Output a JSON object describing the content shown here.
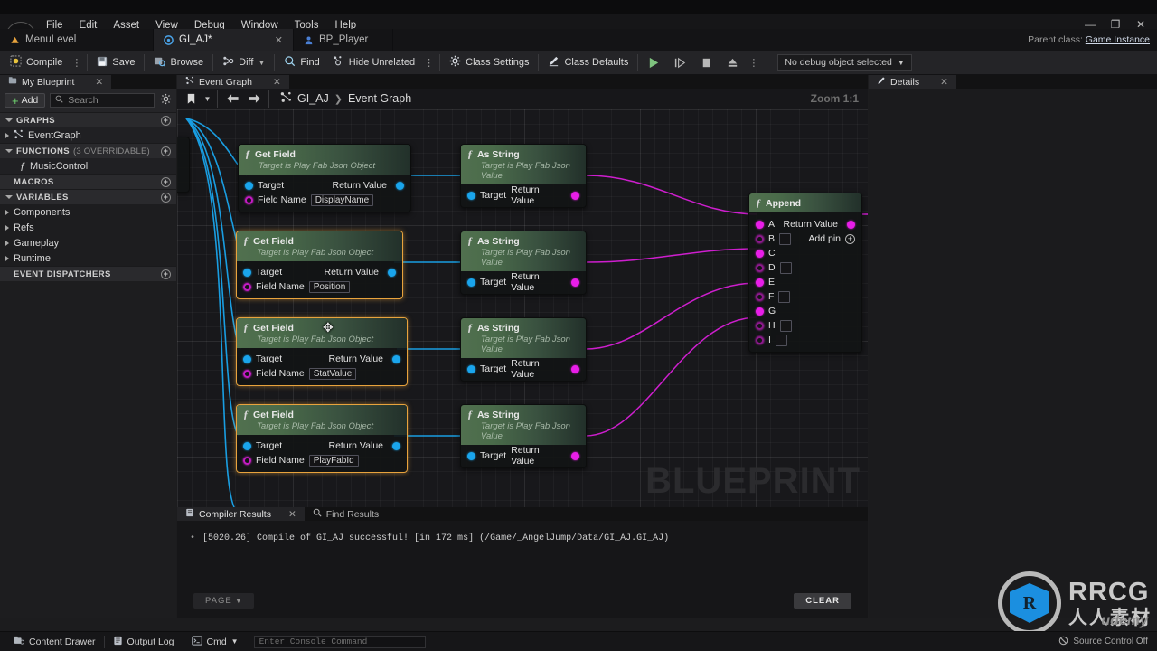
{
  "menu": {
    "items": [
      "File",
      "Edit",
      "Asset",
      "View",
      "Debug",
      "Window",
      "Tools",
      "Help"
    ]
  },
  "window_controls": {
    "minimize": "—",
    "maximize": "❐",
    "close": "✕"
  },
  "asset_tabs": [
    {
      "label": "MenuLevel",
      "icon": "level-icon",
      "active": false,
      "closable": false
    },
    {
      "label": "GI_AJ*",
      "icon": "blueprint-icon",
      "active": true,
      "closable": true,
      "close": "✕"
    },
    {
      "label": "BP_Player",
      "icon": "player-blueprint-icon",
      "active": false,
      "closable": false
    }
  ],
  "parent_class": {
    "label": "Parent class:",
    "value": "Game Instance"
  },
  "toolbar": {
    "compile": "Compile",
    "save": "Save",
    "browse": "Browse",
    "diff": "Diff",
    "find": "Find",
    "hide_unrelated": "Hide Unrelated",
    "class_settings": "Class Settings",
    "class_defaults": "Class Defaults",
    "debug_object": "No debug object selected"
  },
  "my_blueprint": {
    "tab_label": "My Blueprint",
    "add_label": "Add",
    "search_placeholder": "Search",
    "sections": [
      {
        "title": "GRAPHS",
        "sub": "",
        "expanded": true,
        "has_add": true
      },
      {
        "title": "FUNCTIONS",
        "sub": "(3 OVERRIDABLE)",
        "expanded": true,
        "has_add": true
      },
      {
        "title": "MACROS",
        "sub": "",
        "expanded": false,
        "has_add": true
      },
      {
        "title": "VARIABLES",
        "sub": "",
        "expanded": true,
        "has_add": true
      },
      {
        "title": "EVENT DISPATCHERS",
        "sub": "",
        "expanded": false,
        "has_add": true
      }
    ],
    "event_graph": "EventGraph",
    "function_item": "MusicControl",
    "variable_categories": [
      "Components",
      "Refs",
      "Gameplay",
      "Runtime"
    ]
  },
  "graph": {
    "tab_label": "Event Graph",
    "breadcrumb_root": "GI_AJ",
    "breadcrumb_sep": "❯",
    "breadcrumb_current": "Event Graph",
    "zoom_label": "Zoom 1:1",
    "watermark": "BLUEPRINT",
    "nodes": [
      {
        "id": "getfield-1",
        "title": "Get Field",
        "subtitle": "Target is Play Fab Json Object",
        "selected": false,
        "inputs": [
          {
            "label": "Target",
            "type": "object"
          },
          {
            "label": "Field Name",
            "type": "string",
            "value": "DisplayName"
          }
        ],
        "outputs": [
          {
            "label": "Return Value",
            "type": "object"
          }
        ]
      },
      {
        "id": "asstring-1",
        "title": "As String",
        "subtitle": "Target is Play Fab Json Value",
        "selected": false,
        "inputs": [
          {
            "label": "Target",
            "type": "object"
          }
        ],
        "outputs": [
          {
            "label": "Return Value",
            "type": "string"
          }
        ]
      },
      {
        "id": "getfield-2",
        "title": "Get Field",
        "subtitle": "Target is Play Fab Json Object",
        "selected": true,
        "inputs": [
          {
            "label": "Target",
            "type": "object"
          },
          {
            "label": "Field Name",
            "type": "string",
            "value": "Position"
          }
        ],
        "outputs": [
          {
            "label": "Return Value",
            "type": "object"
          }
        ]
      },
      {
        "id": "asstring-2",
        "title": "As String",
        "subtitle": "Target is Play Fab Json Value",
        "selected": false,
        "inputs": [
          {
            "label": "Target",
            "type": "object"
          }
        ],
        "outputs": [
          {
            "label": "Return Value",
            "type": "string"
          }
        ]
      },
      {
        "id": "getfield-3",
        "title": "Get Field",
        "subtitle": "Target is Play Fab Json Object",
        "selected": true,
        "inputs": [
          {
            "label": "Target",
            "type": "object"
          },
          {
            "label": "Field Name",
            "type": "string",
            "value": "StatValue"
          }
        ],
        "outputs": [
          {
            "label": "Return Value",
            "type": "object"
          }
        ]
      },
      {
        "id": "asstring-3",
        "title": "As String",
        "subtitle": "Target is Play Fab Json Value",
        "selected": false,
        "inputs": [
          {
            "label": "Target",
            "type": "object"
          }
        ],
        "outputs": [
          {
            "label": "Return Value",
            "type": "string"
          }
        ]
      },
      {
        "id": "getfield-4",
        "title": "Get Field",
        "subtitle": "Target is Play Fab Json Object",
        "selected": true,
        "inputs": [
          {
            "label": "Target",
            "type": "object"
          },
          {
            "label": "Field Name",
            "type": "string",
            "value": "PlayFabId"
          }
        ],
        "outputs": [
          {
            "label": "Return Value",
            "type": "object"
          }
        ]
      },
      {
        "id": "asstring-4",
        "title": "As String",
        "subtitle": "Target is Play Fab Json Value",
        "selected": false,
        "inputs": [
          {
            "label": "Target",
            "type": "object"
          }
        ],
        "outputs": [
          {
            "label": "Return Value",
            "type": "string"
          }
        ]
      }
    ],
    "append_node": {
      "title": "Append",
      "pins": [
        {
          "label": "A",
          "connected": true,
          "has_field": false
        },
        {
          "label": "B",
          "connected": false,
          "has_field": true,
          "value": ""
        },
        {
          "label": "C",
          "connected": true,
          "has_field": false
        },
        {
          "label": "D",
          "connected": false,
          "has_field": true,
          "value": ""
        },
        {
          "label": "E",
          "connected": true,
          "has_field": false
        },
        {
          "label": "F",
          "connected": false,
          "has_field": true,
          "value": ""
        },
        {
          "label": "G",
          "connected": true,
          "has_field": false
        },
        {
          "label": "H",
          "connected": false,
          "has_field": true,
          "value": ""
        },
        {
          "label": "I",
          "connected": false,
          "has_field": true,
          "value": ""
        }
      ],
      "return_label": "Return Value",
      "add_pin_label": "Add pin"
    }
  },
  "results": {
    "tabs": [
      {
        "label": "Compiler Results",
        "icon": "compiler-icon",
        "active": true,
        "close": "✕"
      },
      {
        "label": "Find Results",
        "icon": "search-icon",
        "active": false
      }
    ],
    "log_bullet": "•",
    "log_line": "[5020.26] Compile of GI_AJ successful! [in 172 ms] (/Game/_AngelJump/Data/GI_AJ.GI_AJ)",
    "page_button": "PAGE",
    "clear_button": "CLEAR"
  },
  "details": {
    "tab_label": "Details",
    "close": "✕"
  },
  "status_bar": {
    "content_drawer": "Content Drawer",
    "output_log": "Output Log",
    "cmd": "Cmd",
    "console_placeholder": "Enter Console Command",
    "source_control": "Source Control Off"
  },
  "watermark": {
    "brand": "RRCG",
    "brand_cn": "人人素材",
    "platform": "udemy"
  },
  "colors": {
    "accent_green": "#51704f",
    "pin_object": "#1aa5ec",
    "pin_string": "#e81ee8",
    "selection": "#e8a33d",
    "canvas": "#18181b"
  }
}
